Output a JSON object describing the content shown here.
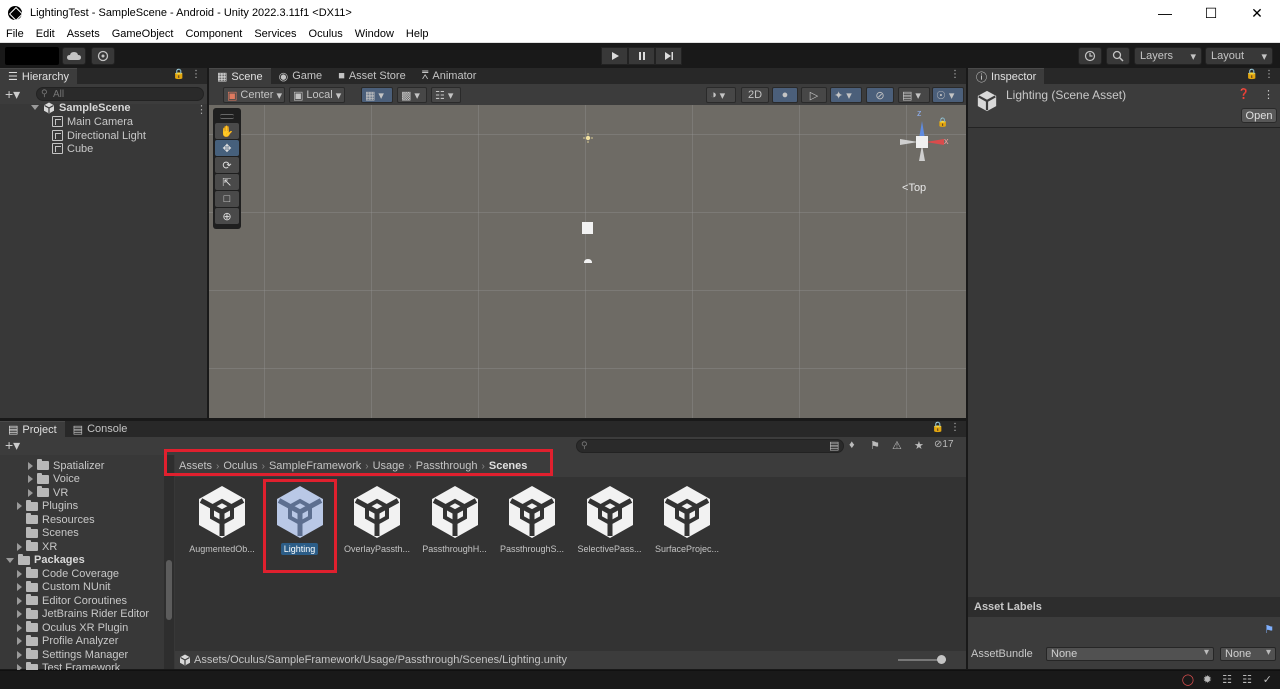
{
  "window": {
    "title": "LightingTest - SampleScene - Android - Unity 2022.3.11f1 <DX11>"
  },
  "menu": [
    "File",
    "Edit",
    "Assets",
    "GameObject",
    "Component",
    "Services",
    "Oculus",
    "Window",
    "Help"
  ],
  "toolbar": {
    "layers_label": "Layers",
    "layout_label": "Layout"
  },
  "hierarchy": {
    "tab_label": "Hierarchy",
    "search_placeholder": "All",
    "scene_name": "SampleScene",
    "items": [
      "Main Camera",
      "Directional Light",
      "Cube"
    ]
  },
  "scene_tabs": [
    "Scene",
    "Game",
    "Asset Store",
    "Animator"
  ],
  "scene_toolbar": {
    "pivot_label": "Center",
    "space_label": "Local",
    "mode_2d": "2D"
  },
  "gizmo": {
    "z_label": "z",
    "x_label": "x",
    "view_label": "Top"
  },
  "inspector": {
    "tab_label": "Inspector",
    "asset_title": "Lighting (Scene Asset)",
    "open_button": "Open",
    "asset_labels_heading": "Asset Labels",
    "asset_bundle_label": "AssetBundle",
    "asset_bundle_value": "None",
    "asset_bundle_variant": "None"
  },
  "project": {
    "tabs": [
      "Project",
      "Console"
    ],
    "hidden_count": "17",
    "tree": [
      {
        "label": "Spatializer",
        "indent": 2,
        "arrow": "right"
      },
      {
        "label": "Voice",
        "indent": 2,
        "arrow": "right"
      },
      {
        "label": "VR",
        "indent": 2,
        "arrow": "right"
      },
      {
        "label": "Plugins",
        "indent": 1,
        "arrow": "right"
      },
      {
        "label": "Resources",
        "indent": 1,
        "arrow": "none"
      },
      {
        "label": "Scenes",
        "indent": 1,
        "arrow": "none"
      },
      {
        "label": "XR",
        "indent": 1,
        "arrow": "right"
      },
      {
        "label": "Packages",
        "indent": 0,
        "arrow": "down",
        "bold": true
      },
      {
        "label": "Code Coverage",
        "indent": 1,
        "arrow": "right"
      },
      {
        "label": "Custom NUnit",
        "indent": 1,
        "arrow": "right"
      },
      {
        "label": "Editor Coroutines",
        "indent": 1,
        "arrow": "right"
      },
      {
        "label": "JetBrains Rider Editor",
        "indent": 1,
        "arrow": "right"
      },
      {
        "label": "Oculus XR Plugin",
        "indent": 1,
        "arrow": "right"
      },
      {
        "label": "Profile Analyzer",
        "indent": 1,
        "arrow": "right"
      },
      {
        "label": "Settings Manager",
        "indent": 1,
        "arrow": "right"
      },
      {
        "label": "Test Framework",
        "indent": 1,
        "arrow": "right"
      }
    ],
    "breadcrumb": [
      "Assets",
      "Oculus",
      "SampleFramework",
      "Usage",
      "Passthrough",
      "Scenes"
    ],
    "assets": [
      "AugmentedOb...",
      "Lighting",
      "OverlayPassth...",
      "PassthroughH...",
      "PassthroughS...",
      "SelectivePass...",
      "SurfaceProjec..."
    ],
    "selected_asset": "Lighting",
    "status_path": "Assets/Oculus/SampleFramework/Usage/Passthrough/Scenes/Lighting.unity"
  },
  "colors": {
    "highlight_red": "#e0202e",
    "selection_blue": "#2c5d87",
    "scene_bg": "#6e6b65"
  }
}
